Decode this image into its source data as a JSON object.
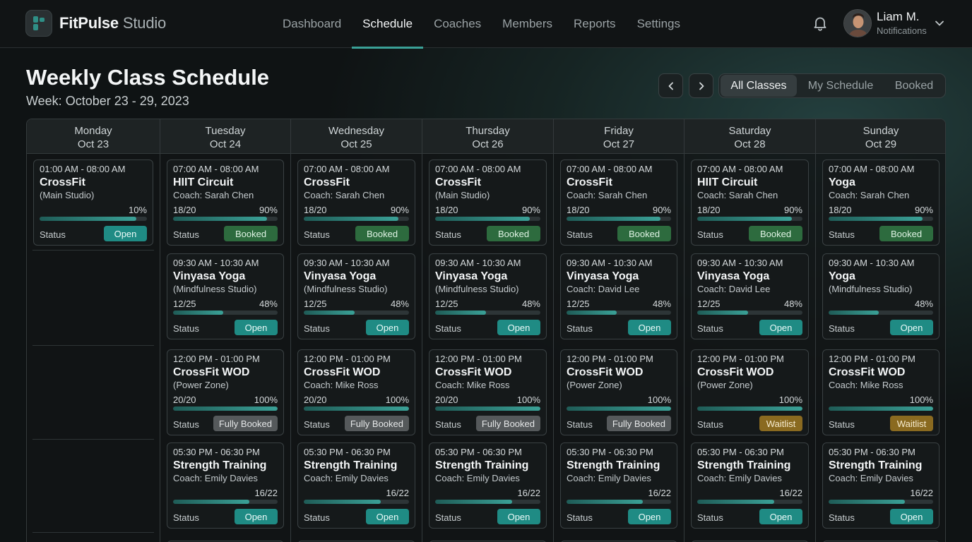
{
  "app": {
    "brand_name": "FitPulse",
    "brand_suffix": "Studio",
    "logo_icon": "logo-mark-icon",
    "accent_color": "#3aa197"
  },
  "nav": {
    "items": [
      "Dashboard",
      "Schedule",
      "Coaches",
      "Members",
      "Reports",
      "Settings"
    ],
    "active": "Schedule"
  },
  "user": {
    "name": "Liam M.",
    "subtitle": "Notifications",
    "icons": [
      "bell-icon",
      "chevron-down-icon"
    ]
  },
  "header": {
    "title": "Weekly Class Schedule",
    "week": "Week: October 23 - 29, 2023",
    "icons": [
      "chevron-left-icon",
      "chevron-right-icon"
    ]
  },
  "filter": {
    "options": [
      "All Classes",
      "My Schedule",
      "Booked"
    ],
    "active": "All Classes"
  },
  "status_label": "Status",
  "status_colors": {
    "Open": "#1f8b84",
    "Booked": "#2d6b3e",
    "Fully Booked": "#55595b",
    "Waitlist": "#8a6a20"
  },
  "days": [
    {
      "name": "Monday",
      "date": "Oct 23",
      "classes": [
        {
          "time": "01:00 AM - 08:00 AM",
          "name": "CrossFit",
          "sub": "(Main Studio)",
          "capacity": "",
          "pct": "10%",
          "fill": 0.9,
          "status": "Open"
        }
      ]
    },
    {
      "name": "Tuesday",
      "date": "Oct 24",
      "classes": [
        {
          "time": "07:00 AM - 08:00 AM",
          "name": "HIIT Circuit",
          "sub": "Coach: Sarah Chen",
          "capacity": "18/20",
          "pct": "90%",
          "fill": 0.9,
          "status": "Booked"
        },
        {
          "time": "09:30 AM - 10:30 AM",
          "name": "Vinyasa Yoga",
          "sub": "(Mindfulness Studio)",
          "capacity": "12/25",
          "pct": "48%",
          "fill": 0.48,
          "status": "Open"
        },
        {
          "time": "12:00 PM - 01:00 PM",
          "name": "CrossFit WOD",
          "sub": "(Power Zone)",
          "capacity": "20/20",
          "pct": "100%",
          "fill": 1.0,
          "status": "Fully Booked"
        },
        {
          "time": "05:30 PM - 06:30 PM",
          "name": "Strength Training",
          "sub": "Coach: Emily Davies",
          "capacity": "",
          "pct": "16/22",
          "fill": 0.73,
          "status": "Open"
        }
      ]
    },
    {
      "name": "Wednesday",
      "date": "Oct 25",
      "classes": [
        {
          "time": "07:00 AM - 08:00 AM",
          "name": "CrossFit",
          "sub": "Coach: Sarah Chen",
          "capacity": "18/20",
          "pct": "90%",
          "fill": 0.9,
          "status": "Booked"
        },
        {
          "time": "09:30 AM - 10:30 AM",
          "name": "Vinyasa Yoga",
          "sub": "(Mindfulness Studio)",
          "capacity": "12/25",
          "pct": "48%",
          "fill": 0.48,
          "status": "Open"
        },
        {
          "time": "12:00 PM - 01:00 PM",
          "name": "CrossFit WOD",
          "sub": "Coach: Mike Ross",
          "capacity": "20/20",
          "pct": "100%",
          "fill": 1.0,
          "status": "Fully Booked"
        },
        {
          "time": "05:30 PM - 06:30 PM",
          "name": "Strength Training",
          "sub": "Coach: Emily Davies",
          "capacity": "",
          "pct": "16/22",
          "fill": 0.73,
          "status": "Open"
        }
      ]
    },
    {
      "name": "Thursday",
      "date": "Oct 26",
      "classes": [
        {
          "time": "07:00 AM - 08:00 AM",
          "name": "CrossFit",
          "sub": "(Main Studio)",
          "capacity": "18/20",
          "pct": "90%",
          "fill": 0.9,
          "status": "Booked"
        },
        {
          "time": "09:30 AM - 10:30 AM",
          "name": "Vinyasa Yoga",
          "sub": "(Mindfulness Studio)",
          "capacity": "12/25",
          "pct": "48%",
          "fill": 0.48,
          "status": "Open"
        },
        {
          "time": "12:00 PM - 01:00 PM",
          "name": "CrossFit WOD",
          "sub": "Coach: Mike Ross",
          "capacity": "20/20",
          "pct": "100%",
          "fill": 1.0,
          "status": "Fully Booked"
        },
        {
          "time": "05:30 PM - 06:30 PM",
          "name": "Strength Training",
          "sub": "Coach: Emily Davies",
          "capacity": "",
          "pct": "16/22",
          "fill": 0.73,
          "status": "Open"
        }
      ]
    },
    {
      "name": "Friday",
      "date": "Oct 27",
      "classes": [
        {
          "time": "07:00 AM - 08:00 AM",
          "name": "CrossFit",
          "sub": "Coach: Sarah Chen",
          "capacity": "18/20",
          "pct": "90%",
          "fill": 0.9,
          "status": "Booked"
        },
        {
          "time": "09:30 AM - 10:30 AM",
          "name": "Vinyasa Yoga",
          "sub": "Coach: David Lee",
          "capacity": "12/25",
          "pct": "48%",
          "fill": 0.48,
          "status": "Open"
        },
        {
          "time": "12:00 PM - 01:00 PM",
          "name": "CrossFit WOD",
          "sub": "(Power Zone)",
          "capacity": "",
          "pct": "100%",
          "fill": 1.0,
          "status": "Fully Booked"
        },
        {
          "time": "05:30 PM - 06:30 PM",
          "name": "Strength Training",
          "sub": "Coach: Emily Davies",
          "capacity": "",
          "pct": "16/22",
          "fill": 0.73,
          "status": "Open"
        }
      ]
    },
    {
      "name": "Saturday",
      "date": "Oct 28",
      "classes": [
        {
          "time": "07:00 AM - 08:00 AM",
          "name": "HIIT Circuit",
          "sub": "Coach: Sarah Chen",
          "capacity": "18/20",
          "pct": "90%",
          "fill": 0.9,
          "status": "Booked"
        },
        {
          "time": "09:30 AM - 10:30 AM",
          "name": "Vinyasa Yoga",
          "sub": "Coach: David Lee",
          "capacity": "12/25",
          "pct": "48%",
          "fill": 0.48,
          "status": "Open"
        },
        {
          "time": "12:00 PM - 01:00 PM",
          "name": "CrossFit WOD",
          "sub": "(Power Zone)",
          "capacity": "",
          "pct": "100%",
          "fill": 1.0,
          "status": "Waitlist"
        },
        {
          "time": "05:30 PM - 06:30 PM",
          "name": "Strength Training",
          "sub": "Coach: Emily Davies",
          "capacity": "",
          "pct": "16/22",
          "fill": 0.73,
          "status": "Open"
        }
      ]
    },
    {
      "name": "Sunday",
      "date": "Oct 29",
      "classes": [
        {
          "time": "07:00 AM - 08:00 AM",
          "name": "Yoga",
          "sub": "Coach: Sarah Chen",
          "capacity": "18/20",
          "pct": "90%",
          "fill": 0.9,
          "status": "Booked"
        },
        {
          "time": "09:30 AM - 10:30 AM",
          "name": "Yoga",
          "sub": "(Mindfulness Studio)",
          "capacity": "",
          "pct": "48%",
          "fill": 0.48,
          "status": "Open"
        },
        {
          "time": "12:00 PM - 01:00 PM",
          "name": "CrossFit WOD",
          "sub": "Coach: Mike Ross",
          "capacity": "",
          "pct": "100%",
          "fill": 1.0,
          "status": "Waitlist"
        },
        {
          "time": "05:30 PM - 06:30 PM",
          "name": "Strength Training",
          "sub": "Coach: Emily Davies",
          "capacity": "",
          "pct": "16/22",
          "fill": 0.73,
          "status": "Open"
        }
      ]
    }
  ]
}
